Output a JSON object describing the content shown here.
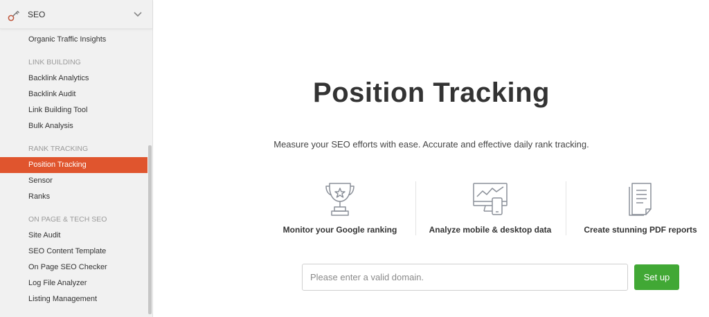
{
  "sidebar": {
    "header": {
      "title": "SEO",
      "icon": "key-icon",
      "expand_icon": "chevron-down-icon"
    },
    "top_item": "Organic Traffic Insights",
    "sections": [
      {
        "title": "LINK BUILDING",
        "items": [
          "Backlink Analytics",
          "Backlink Audit",
          "Link Building Tool",
          "Bulk Analysis"
        ]
      },
      {
        "title": "RANK TRACKING",
        "items": [
          "Position Tracking",
          "Sensor",
          "Ranks"
        ]
      },
      {
        "title": "ON PAGE & TECH SEO",
        "items": [
          "Site Audit",
          "SEO Content Template",
          "On Page SEO Checker",
          "Log File Analyzer",
          "Listing Management"
        ]
      }
    ],
    "active_item": "Position Tracking"
  },
  "main": {
    "title": "Position Tracking",
    "subtitle": "Measure your SEO efforts with ease. Accurate and effective daily rank tracking.",
    "features": [
      {
        "label": "Monitor your Google ranking",
        "icon": "trophy-icon"
      },
      {
        "label": "Analyze mobile & desktop data",
        "icon": "devices-icon"
      },
      {
        "label": "Create stunning PDF reports",
        "icon": "document-icon"
      }
    ],
    "domain_input": {
      "placeholder": "Please enter a valid domain.",
      "value": ""
    },
    "setup_button": "Set up"
  },
  "colors": {
    "active": "#e0552e",
    "button": "#41a835",
    "sidebar_bg": "#f1f1f1"
  }
}
